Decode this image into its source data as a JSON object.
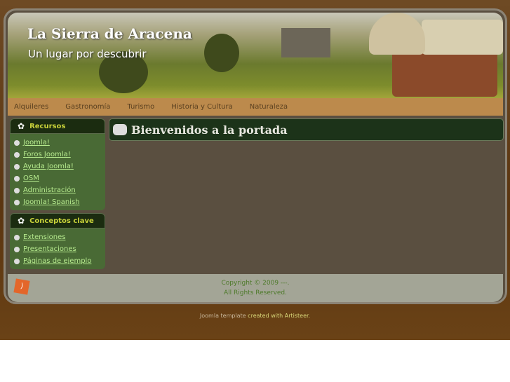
{
  "header": {
    "title": "La Sierra de Aracena",
    "subtitle": "Un lugar por descubrir"
  },
  "nav": [
    "Alquileres",
    "Gastronomía",
    "Turismo",
    "Historia y Cultura",
    "Naturaleza"
  ],
  "blocks": [
    {
      "title": "Recursos",
      "items": [
        "Joomla!",
        "Foros Joomla!",
        "Ayuda Joomla!",
        "OSM",
        "Administración",
        "Joomla! Spanish"
      ]
    },
    {
      "title": "Conceptos clave",
      "items": [
        "Extensiones",
        "Presentaciones",
        "Páginas de ejemplo"
      ]
    }
  ],
  "main": {
    "title": "Bienvenidos a la portada"
  },
  "footer": {
    "line1": "Copyright © 2009 ---.",
    "line2": "All Rights Reserved."
  },
  "credit": {
    "link": "Joomla template",
    "text": " created with Artisteer."
  }
}
